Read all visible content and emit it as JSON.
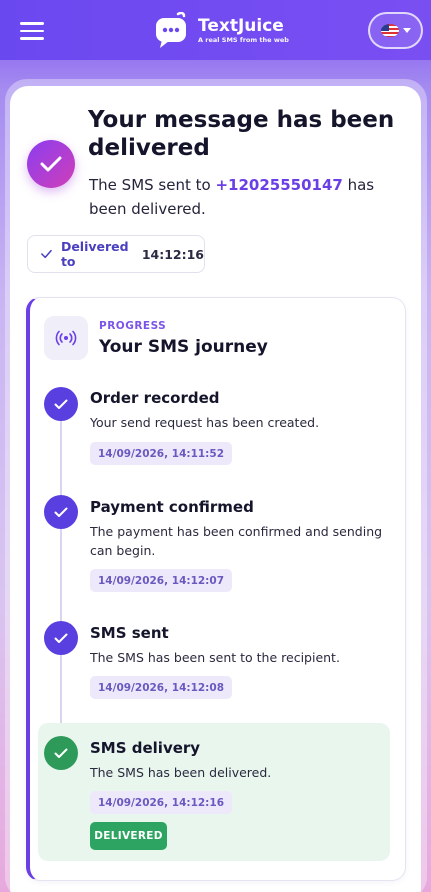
{
  "header": {
    "menu_icon": "hamburger-icon",
    "brand_name": "TextJuice",
    "brand_tagline": "A real SMS from the web",
    "language_flag": "us-flag-icon"
  },
  "status": {
    "title": "Your message has been delivered",
    "subtitle_pre": "The SMS sent to ",
    "phone": "+12025550147",
    "subtitle_post": " has been delivered.",
    "delivered_label": "Delivered to",
    "delivered_time": "14:12:16"
  },
  "journey": {
    "kicker": "PROGRESS",
    "title": "Your SMS journey",
    "steps": [
      {
        "title": "Order recorded",
        "description": "Your send request has been created.",
        "timestamp": "14/09/2026, 14:11:52"
      },
      {
        "title": "Payment confirmed",
        "description": "The payment has been confirmed and sending can begin.",
        "timestamp": "14/09/2026, 14:12:07"
      },
      {
        "title": "SMS sent",
        "description": "The SMS has been sent to the recipient.",
        "timestamp": "14/09/2026, 14:12:08"
      },
      {
        "title": "SMS delivery",
        "description": "The SMS has been delivered.",
        "timestamp": "14/09/2026, 14:12:16",
        "badge": "DELIVERED"
      }
    ]
  },
  "colors": {
    "primary": "#6a3fe6",
    "success": "#2ea462",
    "header": "#6a48f0"
  }
}
